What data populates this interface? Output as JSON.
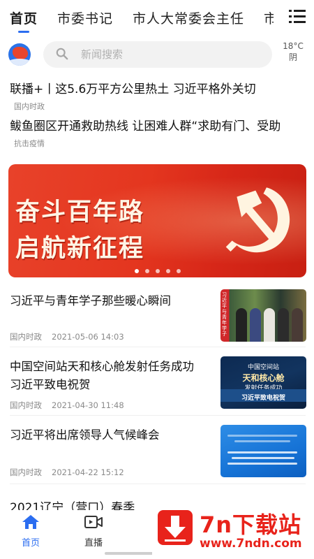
{
  "tabs": [
    "首页",
    "市委书记",
    "市人大常委会主任",
    "市"
  ],
  "search": {
    "placeholder": "新闻搜索"
  },
  "weather": {
    "temp": "18°C",
    "condition": "阴"
  },
  "headlines": [
    {
      "title": "联播+丨这5.6万平方公里热土 习近平格外关切",
      "tag": "国内时政"
    },
    {
      "title": "鲅鱼圈区开通救助热线 让困难人群“求助有门、受助",
      "tag": "抗击疫情"
    }
  ],
  "banner": {
    "line1": "奋斗百年路",
    "line2": "启航新征程",
    "slides": 5,
    "active_slide": 1
  },
  "news": [
    {
      "title": "习近平与青年学子那些暖心瞬间",
      "category": "国内时政",
      "date": "2021-05-06 14:03",
      "thumb_side_text": "习近平与青年学子"
    },
    {
      "title": "中国空间站天和核心舱发射任务成功 习近平致电祝贺",
      "category": "国内时政",
      "date": "2021-04-30 11:48",
      "thumb_text_1": "中国空间站",
      "thumb_text_2": "天和核心舱",
      "thumb_text_3": "发射任务成功",
      "thumb_band": "习近平致电祝贺"
    },
    {
      "title": "习近平将出席领导人气候峰会",
      "category": "国内时政",
      "date": "2021-04-22 15:12"
    },
    {
      "title": "2021辽宁（营口）春季"
    }
  ],
  "bottom_nav": {
    "home": "首页",
    "live": "直播"
  },
  "watermark": {
    "title": "7n下载站",
    "url": "www.7ndn.com"
  },
  "colors": {
    "accent": "#2b6df0",
    "banner_red": "#e4361f",
    "watermark_red": "#e8231b"
  }
}
